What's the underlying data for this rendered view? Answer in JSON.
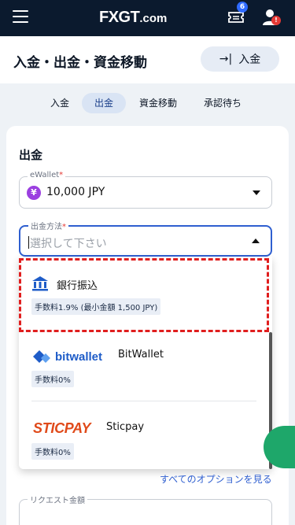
{
  "topbar": {
    "logo": "FXGT",
    "logo_suffix": ".com",
    "ticket_badge": "6",
    "user_badge": "!"
  },
  "header": {
    "title": "入金・出金・資金移動",
    "deposit_button": "入金"
  },
  "tabs": [
    {
      "label": "入金"
    },
    {
      "label": "出金",
      "active": true
    },
    {
      "label": "資金移動"
    },
    {
      "label": "承認待ち"
    }
  ],
  "form": {
    "title": "出金",
    "ewallet": {
      "label": "eWallet",
      "currency_symbol": "¥",
      "value": "10,000 JPY"
    },
    "method": {
      "label": "出金方法",
      "placeholder": "選択して下さい"
    },
    "options": [
      {
        "name": "銀行振込",
        "fee": "手数料1.9% (最小金額 1,500 JPY)"
      },
      {
        "logo_text": "bitwallet",
        "name": "BitWallet",
        "fee": "手数料0%"
      },
      {
        "logo_text": "STICPAY",
        "name": "Sticpay",
        "fee": "手数料0%"
      }
    ],
    "see_all": "すべてのオプションを見る",
    "request_amount": {
      "label": "リクエスト金額"
    }
  },
  "colors": {
    "accent": "#2f5fd0",
    "topbar": "#0b1a2e",
    "highlight": "#e01e1e"
  }
}
